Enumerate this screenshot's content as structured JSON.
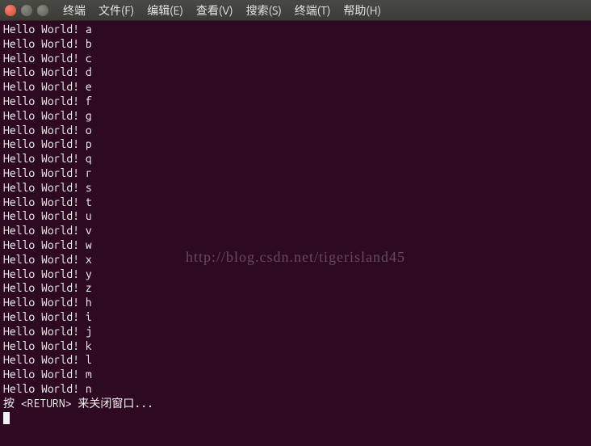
{
  "titlebar": {
    "app_label": "终端",
    "menus": [
      {
        "label": "文件(F)"
      },
      {
        "label": "编辑(E)"
      },
      {
        "label": "查看(V)"
      },
      {
        "label": "搜索(S)"
      },
      {
        "label": "终端(T)"
      },
      {
        "label": "帮助(H)"
      }
    ]
  },
  "terminal": {
    "lines": [
      "Hello World! a",
      "Hello World! b",
      "Hello World! c",
      "Hello World! d",
      "Hello World! e",
      "Hello World! f",
      "Hello World! g",
      "Hello World! o",
      "Hello World! p",
      "Hello World! q",
      "Hello World! r",
      "Hello World! s",
      "Hello World! t",
      "Hello World! u",
      "Hello World! v",
      "Hello World! w",
      "Hello World! x",
      "Hello World! y",
      "Hello World! z",
      "Hello World! h",
      "Hello World! i",
      "Hello World! j",
      "Hello World! k",
      "Hello World! l",
      "Hello World! m",
      "Hello World! n"
    ],
    "prompt_close": "按 <RETURN> 来关闭窗口..."
  },
  "watermark": "http://blog.csdn.net/tigerisland45"
}
